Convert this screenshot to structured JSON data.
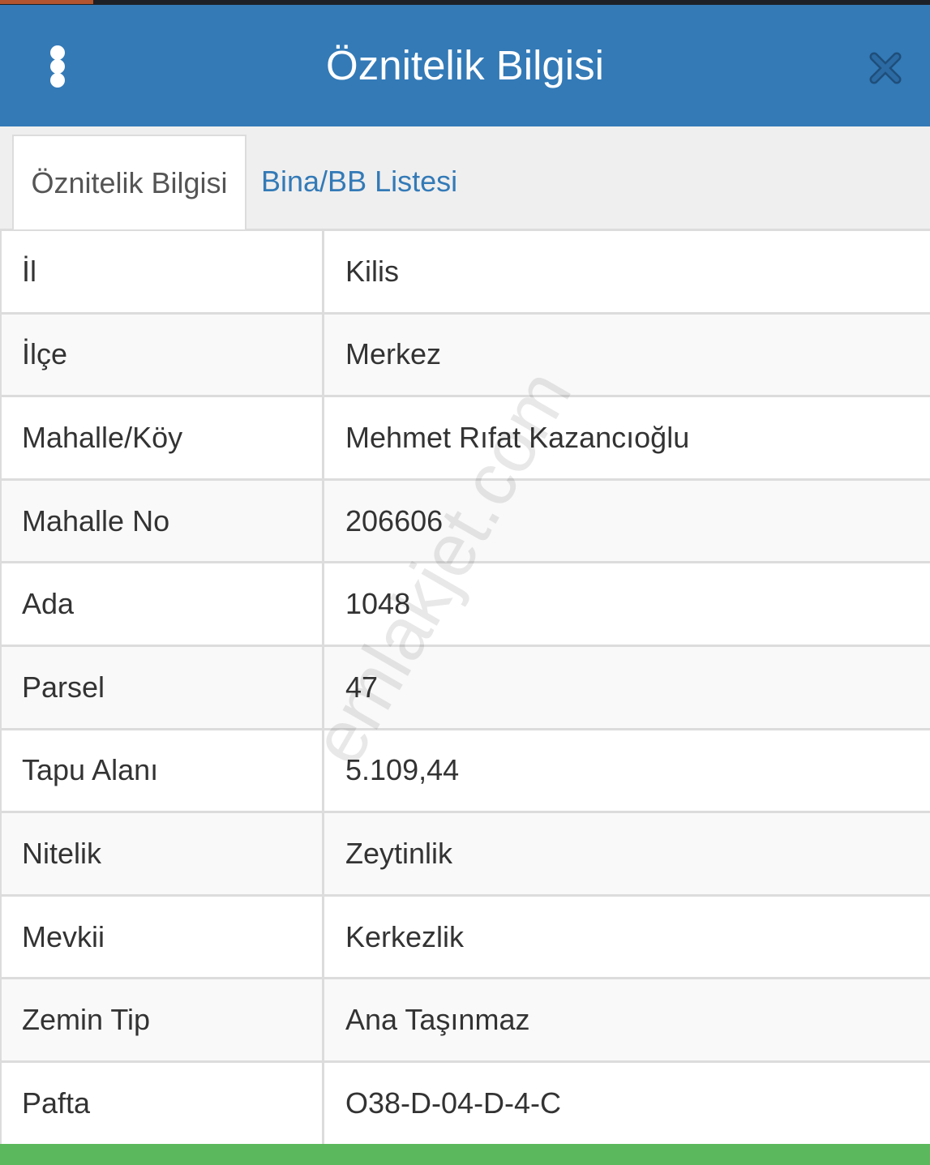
{
  "header": {
    "title": "Öznitelik Bilgisi",
    "menu_icon": "more-vertical-icon",
    "close_icon": "close-icon",
    "bg_color": "#337ab7"
  },
  "tabs": [
    {
      "label": "Öznitelik Bilgisi",
      "active": true
    },
    {
      "label": "Bina/BB Listesi",
      "active": false
    }
  ],
  "attributes": {
    "rows": [
      {
        "label": "İl",
        "value": "Kilis"
      },
      {
        "label": "İlçe",
        "value": "Merkez"
      },
      {
        "label": "Mahalle/Köy",
        "value": "Mehmet Rıfat Kazancıoğlu"
      },
      {
        "label": "Mahalle No",
        "value": "206606"
      },
      {
        "label": "Ada",
        "value": "1048"
      },
      {
        "label": "Parsel",
        "value": "47"
      },
      {
        "label": "Tapu Alanı",
        "value": "5.109,44"
      },
      {
        "label": "Nitelik",
        "value": "Zeytinlik"
      },
      {
        "label": "Mevkii",
        "value": "Kerkezlik"
      },
      {
        "label": "Zemin Tip",
        "value": "Ana Taşınmaz"
      },
      {
        "label": "Pafta",
        "value": "O38-D-04-D-4-C"
      }
    ]
  },
  "watermark": "emlakjet.com",
  "colors": {
    "accent": "#337ab7",
    "footer": "#5cb85c",
    "border": "#dcdcdc"
  }
}
